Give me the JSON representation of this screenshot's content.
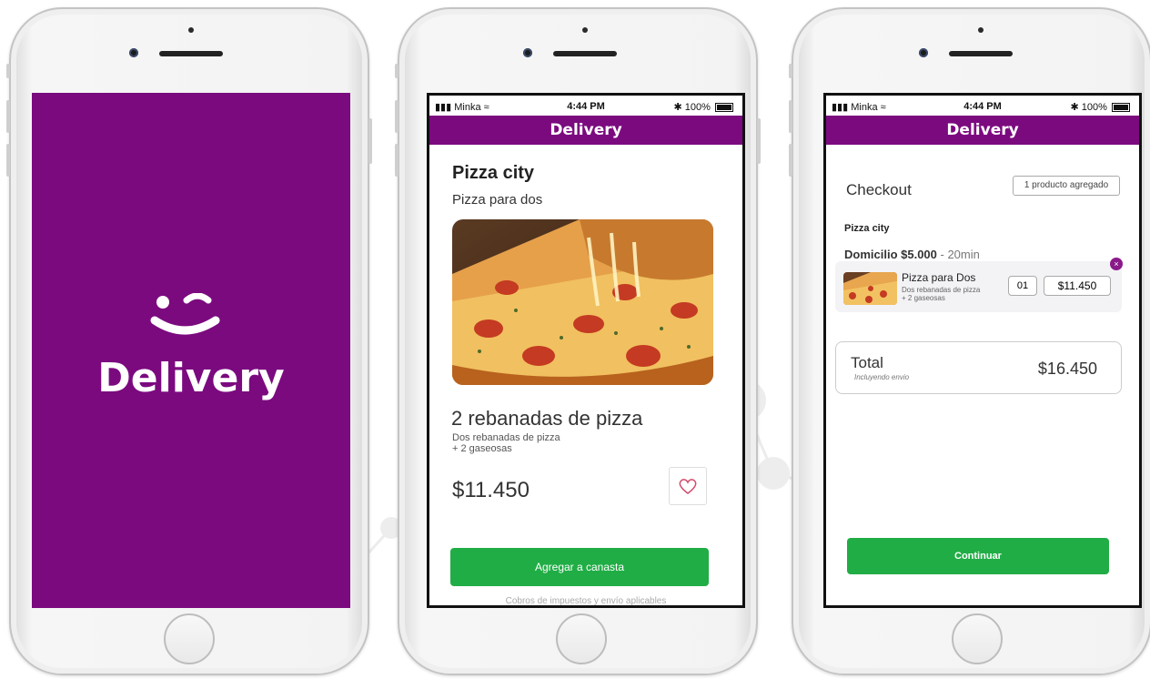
{
  "colors": {
    "brand": "#7b0a7f",
    "accent_green": "#20ad45",
    "remove_badge": "#8a1a8a"
  },
  "splash": {
    "logo_icon": "smile-icon",
    "wordmark": "Delivery"
  },
  "status_bar": {
    "carrier": "Minka",
    "time": "4:44 PM",
    "battery": "100%",
    "signal_icon": "signal-icon",
    "wifi_icon": "wifi-icon",
    "bluetooth_icon": "bluetooth-icon"
  },
  "app_bar": {
    "title": "Delivery"
  },
  "product": {
    "restaurant": "Pizza city",
    "subtitle": "Pizza para dos",
    "item_name": "2 rebanadas de pizza",
    "item_desc_line1": "Dos rebanadas de pizza",
    "item_desc_line2": "+ 2 gaseosas",
    "price": "$11.450",
    "favorite_icon": "heart-icon",
    "add_button": "Agregar a canasta",
    "footer_note": "Cobros de impuestos y envío aplicables"
  },
  "checkout": {
    "title": "Checkout",
    "badge": "1 producto agregado",
    "restaurant": "Pizza city",
    "delivery_label": "Domicilio $5.000",
    "delivery_time": " - 20min",
    "item": {
      "name": "Pizza para Dos",
      "desc_line1": "Dos rebanadas de pizza",
      "desc_line2": "+ 2 gaseosas",
      "qty": "01",
      "price": "$11.450",
      "remove_symbol": "×"
    },
    "total_label": "Total",
    "total_sub": "Incluyendo envio",
    "total_amount": "$16.450",
    "continue_button": "Continuar"
  }
}
